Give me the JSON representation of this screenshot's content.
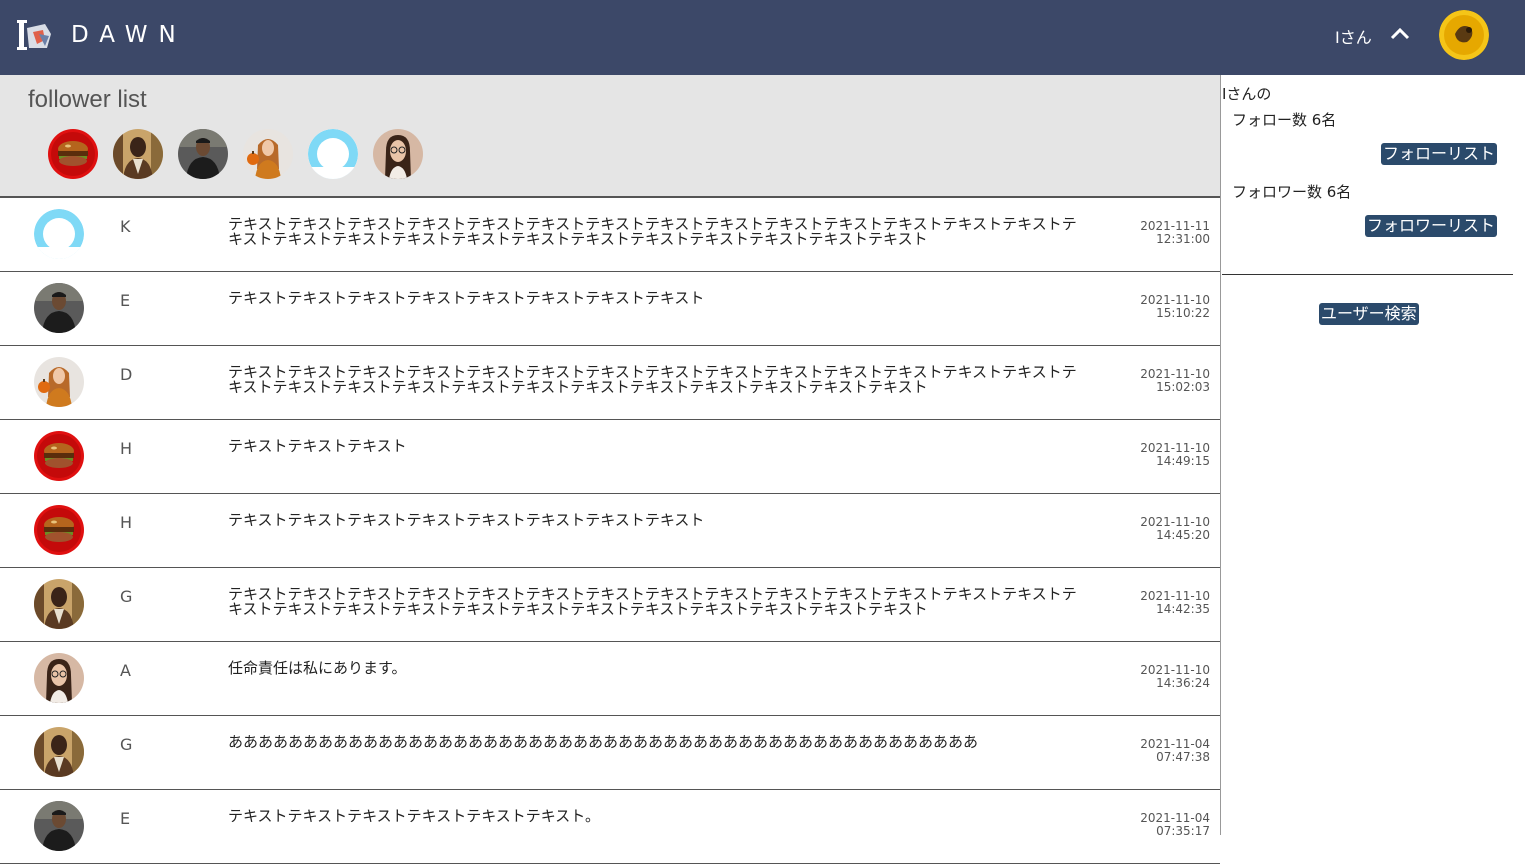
{
  "header": {
    "brand": "DAWN",
    "user_name": "Iさん",
    "colors": {
      "background": "#3c4868"
    }
  },
  "follower_panel": {
    "title": "follower list",
    "avatars": [
      "burger-avatar",
      "man-brown-jacket-avatar",
      "man-black-shirt-avatar",
      "woman-pumpkin-avatar",
      "default-avatar",
      "woman-glasses-avatar"
    ]
  },
  "posts": [
    {
      "name": "K",
      "avatar": "default-avatar",
      "text": "テキストテキストテキストテキストテキストテキストテキストテキストテキストテキストテキストテキストテキストテキストテキストテキストテキストテキストテキストテキストテキストテキストテキストテキストテキストテキスト",
      "date": "2021-11-11",
      "time": "12:31:00"
    },
    {
      "name": "E",
      "avatar": "man-black-shirt-avatar",
      "text": "テキストテキストテキストテキストテキストテキストテキストテキスト",
      "date": "2021-11-10",
      "time": "15:10:22"
    },
    {
      "name": "D",
      "avatar": "woman-pumpkin-avatar",
      "text": "テキストテキストテキストテキストテキストテキストテキストテキストテキストテキストテキストテキストテキストテキストテキストテキストテキストテキストテキストテキストテキストテキストテキストテキストテキストテキスト",
      "date": "2021-11-10",
      "time": "15:02:03"
    },
    {
      "name": "H",
      "avatar": "burger-avatar",
      "text": "テキストテキストテキスト",
      "date": "2021-11-10",
      "time": "14:49:15"
    },
    {
      "name": "H",
      "avatar": "burger-avatar",
      "text": "テキストテキストテキストテキストテキストテキストテキストテキスト",
      "date": "2021-11-10",
      "time": "14:45:20"
    },
    {
      "name": "G",
      "avatar": "man-brown-jacket-avatar",
      "text": "テキストテキストテキストテキストテキストテキストテキストテキストテキストテキストテキストテキストテキストテキストテキストテキストテキストテキストテキストテキストテキストテキストテキストテキストテキストテキスト",
      "date": "2021-11-10",
      "time": "14:42:35"
    },
    {
      "name": "A",
      "avatar": "woman-glasses-avatar",
      "text": "任命責任は私にあります。",
      "date": "2021-11-10",
      "time": "14:36:24"
    },
    {
      "name": "G",
      "avatar": "man-brown-jacket-avatar",
      "text": "ああああああああああああああああああああああああああああああああああああああああああああああああああ",
      "date": "2021-11-04",
      "time": "07:47:38"
    },
    {
      "name": "E",
      "avatar": "man-black-shirt-avatar",
      "text": "テキストテキストテキストテキストテキストテキスト。",
      "date": "2021-11-04",
      "time": "07:35:17"
    }
  ],
  "sidebar": {
    "owner_label": "Iさんの",
    "follow_count": "フォロー数 6名",
    "follow_list_button": "フォローリスト",
    "follower_count": "フォロワー数 6名",
    "follower_list_button": "フォロワーリスト",
    "user_search_button": "ユーザー検索",
    "colors": {
      "button": "#2b4a6b"
    }
  }
}
